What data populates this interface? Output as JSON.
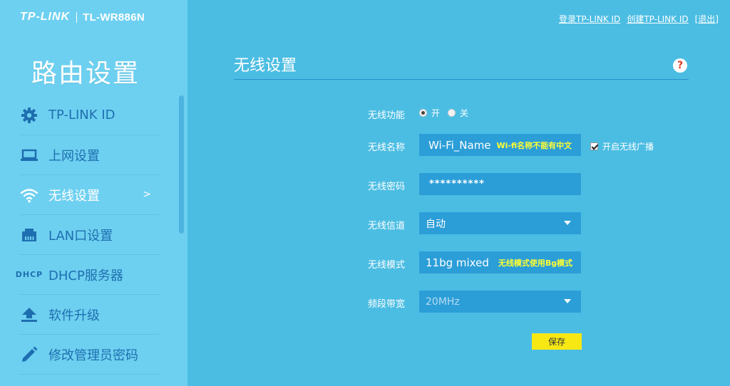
{
  "header": {
    "brand": "TP-LINK",
    "model": "TL-WR886N",
    "links": [
      "登录TP-LINK ID",
      "创建TP-LINK ID",
      "[退出]"
    ]
  },
  "sidebar": {
    "title": "路由设置",
    "items": [
      {
        "label": "TP-LINK ID",
        "icon": "gear-icon"
      },
      {
        "label": "上网设置",
        "icon": "laptop-icon"
      },
      {
        "label": "无线设置",
        "icon": "wifi-icon",
        "active": true,
        "arrow": ">"
      },
      {
        "label": "LAN口设置",
        "icon": "lan-port-icon"
      },
      {
        "label": "DHCP服务器",
        "icon": "dhcp-icon",
        "icon_text": [
          "DH",
          "CP"
        ]
      },
      {
        "label": "软件升级",
        "icon": "upload-icon"
      },
      {
        "label": "修改管理员密码",
        "icon": "pencil-icon"
      }
    ]
  },
  "main": {
    "title": "无线设置",
    "help": "?",
    "wireless_function": {
      "label": "无线功能",
      "options": [
        "开",
        "关"
      ],
      "selected": "开"
    },
    "ssid": {
      "label": "无线名称",
      "value": "Wi-Fi_Name",
      "note": "Wi-fi名称不能有中文"
    },
    "broadcast": {
      "label": "开启无线广播",
      "checked": true
    },
    "password": {
      "label": "无线密码",
      "value": "**********"
    },
    "channel": {
      "label": "无线信道",
      "value": "自动"
    },
    "mode": {
      "label": "无线模式",
      "value": "11bg mixed",
      "note": "无线模式使用Bg模式"
    },
    "bandwidth": {
      "label": "频段带宽",
      "value": "20MHz",
      "disabled": true
    },
    "save_label": "保存"
  },
  "colors": {
    "background": "#4bbde3",
    "sidebar": "#6ed0f0",
    "field": "#2b9ed8",
    "nav_text": "#1e6fb0",
    "save_button": "#f7e814",
    "warning_text": "#ffff33"
  }
}
